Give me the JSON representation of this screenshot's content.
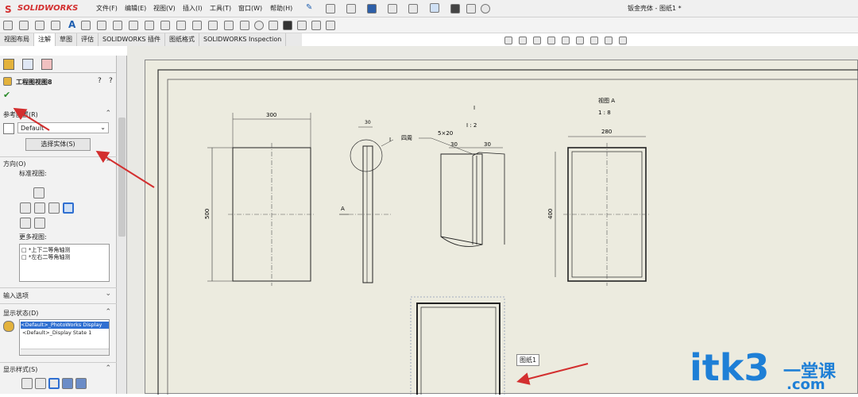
{
  "app": {
    "brand": "SOLIDWORKS",
    "title": "钣金壳体 - 图纸1 *"
  },
  "menu": [
    "文件(F)",
    "编辑(E)",
    "视图(V)",
    "插入(I)",
    "工具(T)",
    "窗口(W)",
    "帮助(H)"
  ],
  "tabs": [
    "视图布局",
    "注解",
    "草图",
    "评估",
    "SOLIDWORKS 插件",
    "图纸格式",
    "SOLIDWORKS Inspection"
  ],
  "panel": {
    "title": "工程图视图8",
    "reference_config_label": "参考配置(R)",
    "config_value": "Default",
    "select_entity_button": "选择实体(S)",
    "orientation_label": "方向(O)",
    "standard_views_label": "标准视图:",
    "more_views_label": "更多视图:",
    "more_views": [
      "*上下二等角轴测",
      "*左右二等角轴测"
    ],
    "import_options_label": "输入选项",
    "display_state_label": "显示状态(D)",
    "display_states": [
      "<Default>_PhotoWorks Display",
      "<Default>_Display State 1"
    ],
    "display_style_label": "显示样式(S)"
  },
  "drawing": {
    "dim_300": "300",
    "dim_500": "500",
    "dim_30a": "30",
    "dim_30b": "30",
    "dim_30c": "30",
    "dim_280": "280",
    "dim_400": "400",
    "detail_label": "I",
    "detail_scale": "I : 2",
    "weld_label": "四周",
    "weld_spec": "5×20",
    "view_label": "视图 A",
    "view_scale": "1 : 8",
    "arrow_label": "A",
    "tooltip": "图纸1"
  },
  "watermark": {
    "text": "itk3",
    "sub_text": "一堂课",
    "tld": ".com"
  },
  "colors": {
    "accent": "#d32f2f",
    "watermark": "#1e7fd6",
    "selection": "#2f6fd1"
  }
}
